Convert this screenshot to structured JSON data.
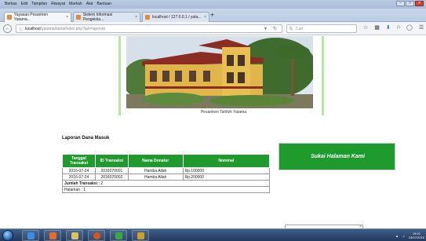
{
  "menubar": {
    "items": [
      "Berkas",
      "Edit",
      "Tampilan",
      "Riwayat",
      "Markah",
      "Alat",
      "Bantuan"
    ],
    "controls": [
      "–",
      "□",
      "×"
    ]
  },
  "tabs": [
    {
      "label": "Yayasan Pesantren Yatama...",
      "close": "×",
      "color": "#e8893a"
    },
    {
      "label": "Sistem Informasi Pengelola...",
      "close": "×",
      "color": "#e8893a"
    },
    {
      "label": "localhost / 127.0.0.1 / yata...",
      "close": "×",
      "color": "#e8893a"
    }
  ],
  "newtab": "+",
  "navbar": {
    "host": "localhost",
    "path": "/yatama/dana/index.php?lah=laporan",
    "search_placeholder": "Cari",
    "search_engine": "G"
  },
  "hero": {
    "caption": "Pesantren Tahfizh Yatama"
  },
  "report": {
    "title": "Laporan Dana Masuk",
    "headers": [
      "Tanggal Transaksi",
      "ID Transaksi",
      "Nama Donatur",
      "Nominal"
    ],
    "rows": [
      [
        "2016-07-24",
        "2016070001",
        "Hamba Allah",
        "Rp.100000"
      ],
      [
        "2016-07-24",
        "2016070002",
        "Hamba Allah",
        "Rp.200000"
      ]
    ],
    "total_label": "Jumlah Transaksi :",
    "total_value": "2",
    "page_label": "Halaman :",
    "page_value": "1"
  },
  "sidebar": {
    "title": "Sukai Halaman Kami"
  },
  "taskbar": {
    "clock_time": "19:21",
    "clock_date": "24/07/2016"
  },
  "colors": {
    "accent": "#1f9b2e",
    "frame": "#b9e4a5"
  }
}
